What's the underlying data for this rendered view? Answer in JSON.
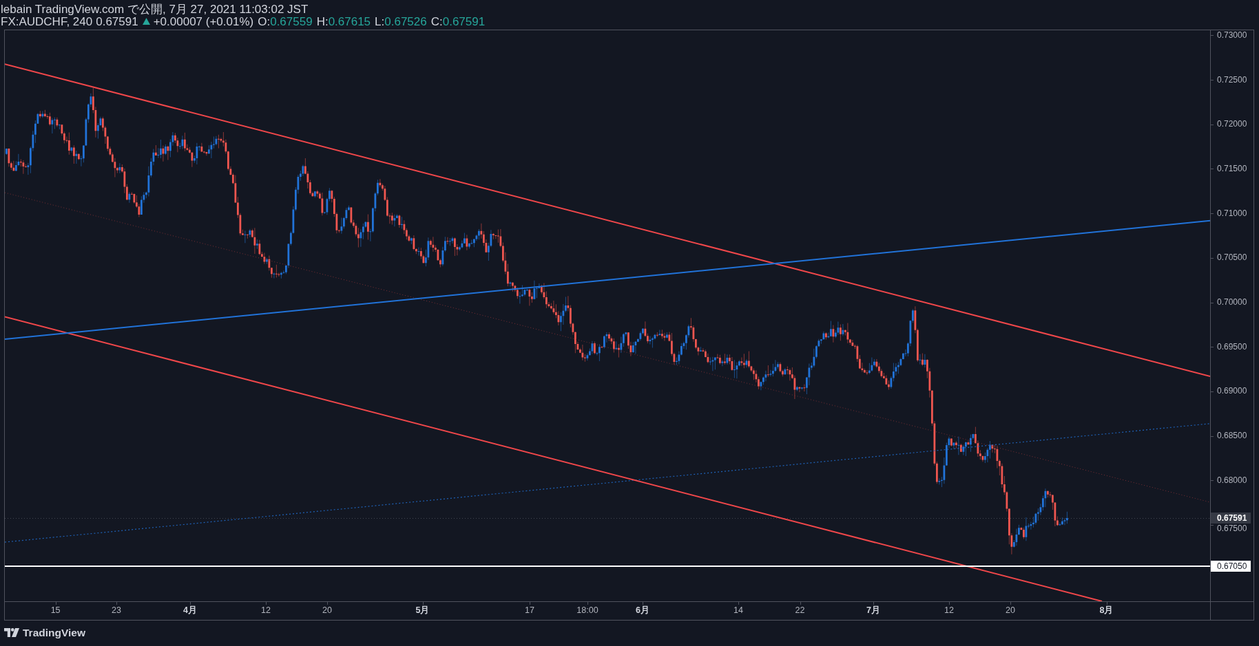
{
  "header": {
    "publisher_line": "lebain TradingView.com で公開, 7月 27, 2021 11:03:02 JST",
    "symbol": "FX:AUDCHF, 240",
    "last_price": "0.67591",
    "rising": true,
    "change": "+0.00007 (+0.01%)",
    "ohlc": [
      {
        "label": "O:",
        "value": "0.67559"
      },
      {
        "label": "H:",
        "value": "0.67615"
      },
      {
        "label": "L:",
        "value": "0.67526"
      },
      {
        "label": "C:",
        "value": "0.67591"
      }
    ]
  },
  "chart": {
    "price_axis": [
      "0.73000",
      "0.72500",
      "0.72000",
      "0.71500",
      "0.71000",
      "0.70500",
      "0.70000",
      "0.69500",
      "0.69000",
      "0.68500",
      "0.68000",
      "0.67500"
    ],
    "last_price_tag": "0.67591",
    "level_line_tag": "0.67050",
    "time_axis": [
      {
        "label": "15",
        "kind": "day"
      },
      {
        "label": "23",
        "kind": "day"
      },
      {
        "label": "4月",
        "kind": "month"
      },
      {
        "label": "12",
        "kind": "day"
      },
      {
        "label": "20",
        "kind": "day"
      },
      {
        "label": "5月",
        "kind": "month"
      },
      {
        "label": "17",
        "kind": "day"
      },
      {
        "label": "18:00",
        "kind": "time"
      },
      {
        "label": "6月",
        "kind": "month"
      },
      {
        "label": "14",
        "kind": "day"
      },
      {
        "label": "22",
        "kind": "day"
      },
      {
        "label": "7月",
        "kind": "month"
      },
      {
        "label": "12",
        "kind": "day"
      },
      {
        "label": "20",
        "kind": "day"
      },
      {
        "label": "8月",
        "kind": "month"
      }
    ]
  },
  "footer": {
    "brand": "TradingView"
  }
}
